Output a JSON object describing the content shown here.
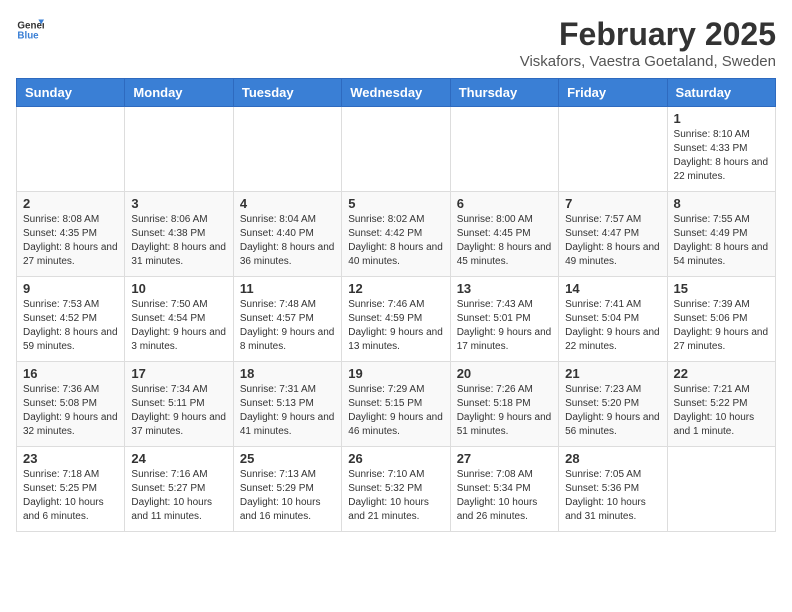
{
  "logo": {
    "general": "General",
    "blue": "Blue"
  },
  "title": "February 2025",
  "subtitle": "Viskafors, Vaestra Goetaland, Sweden",
  "days_of_week": [
    "Sunday",
    "Monday",
    "Tuesday",
    "Wednesday",
    "Thursday",
    "Friday",
    "Saturday"
  ],
  "weeks": [
    [
      {
        "day": "",
        "info": ""
      },
      {
        "day": "",
        "info": ""
      },
      {
        "day": "",
        "info": ""
      },
      {
        "day": "",
        "info": ""
      },
      {
        "day": "",
        "info": ""
      },
      {
        "day": "",
        "info": ""
      },
      {
        "day": "1",
        "info": "Sunrise: 8:10 AM\nSunset: 4:33 PM\nDaylight: 8 hours and 22 minutes."
      }
    ],
    [
      {
        "day": "2",
        "info": "Sunrise: 8:08 AM\nSunset: 4:35 PM\nDaylight: 8 hours and 27 minutes."
      },
      {
        "day": "3",
        "info": "Sunrise: 8:06 AM\nSunset: 4:38 PM\nDaylight: 8 hours and 31 minutes."
      },
      {
        "day": "4",
        "info": "Sunrise: 8:04 AM\nSunset: 4:40 PM\nDaylight: 8 hours and 36 minutes."
      },
      {
        "day": "5",
        "info": "Sunrise: 8:02 AM\nSunset: 4:42 PM\nDaylight: 8 hours and 40 minutes."
      },
      {
        "day": "6",
        "info": "Sunrise: 8:00 AM\nSunset: 4:45 PM\nDaylight: 8 hours and 45 minutes."
      },
      {
        "day": "7",
        "info": "Sunrise: 7:57 AM\nSunset: 4:47 PM\nDaylight: 8 hours and 49 minutes."
      },
      {
        "day": "8",
        "info": "Sunrise: 7:55 AM\nSunset: 4:49 PM\nDaylight: 8 hours and 54 minutes."
      }
    ],
    [
      {
        "day": "9",
        "info": "Sunrise: 7:53 AM\nSunset: 4:52 PM\nDaylight: 8 hours and 59 minutes."
      },
      {
        "day": "10",
        "info": "Sunrise: 7:50 AM\nSunset: 4:54 PM\nDaylight: 9 hours and 3 minutes."
      },
      {
        "day": "11",
        "info": "Sunrise: 7:48 AM\nSunset: 4:57 PM\nDaylight: 9 hours and 8 minutes."
      },
      {
        "day": "12",
        "info": "Sunrise: 7:46 AM\nSunset: 4:59 PM\nDaylight: 9 hours and 13 minutes."
      },
      {
        "day": "13",
        "info": "Sunrise: 7:43 AM\nSunset: 5:01 PM\nDaylight: 9 hours and 17 minutes."
      },
      {
        "day": "14",
        "info": "Sunrise: 7:41 AM\nSunset: 5:04 PM\nDaylight: 9 hours and 22 minutes."
      },
      {
        "day": "15",
        "info": "Sunrise: 7:39 AM\nSunset: 5:06 PM\nDaylight: 9 hours and 27 minutes."
      }
    ],
    [
      {
        "day": "16",
        "info": "Sunrise: 7:36 AM\nSunset: 5:08 PM\nDaylight: 9 hours and 32 minutes."
      },
      {
        "day": "17",
        "info": "Sunrise: 7:34 AM\nSunset: 5:11 PM\nDaylight: 9 hours and 37 minutes."
      },
      {
        "day": "18",
        "info": "Sunrise: 7:31 AM\nSunset: 5:13 PM\nDaylight: 9 hours and 41 minutes."
      },
      {
        "day": "19",
        "info": "Sunrise: 7:29 AM\nSunset: 5:15 PM\nDaylight: 9 hours and 46 minutes."
      },
      {
        "day": "20",
        "info": "Sunrise: 7:26 AM\nSunset: 5:18 PM\nDaylight: 9 hours and 51 minutes."
      },
      {
        "day": "21",
        "info": "Sunrise: 7:23 AM\nSunset: 5:20 PM\nDaylight: 9 hours and 56 minutes."
      },
      {
        "day": "22",
        "info": "Sunrise: 7:21 AM\nSunset: 5:22 PM\nDaylight: 10 hours and 1 minute."
      }
    ],
    [
      {
        "day": "23",
        "info": "Sunrise: 7:18 AM\nSunset: 5:25 PM\nDaylight: 10 hours and 6 minutes."
      },
      {
        "day": "24",
        "info": "Sunrise: 7:16 AM\nSunset: 5:27 PM\nDaylight: 10 hours and 11 minutes."
      },
      {
        "day": "25",
        "info": "Sunrise: 7:13 AM\nSunset: 5:29 PM\nDaylight: 10 hours and 16 minutes."
      },
      {
        "day": "26",
        "info": "Sunrise: 7:10 AM\nSunset: 5:32 PM\nDaylight: 10 hours and 21 minutes."
      },
      {
        "day": "27",
        "info": "Sunrise: 7:08 AM\nSunset: 5:34 PM\nDaylight: 10 hours and 26 minutes."
      },
      {
        "day": "28",
        "info": "Sunrise: 7:05 AM\nSunset: 5:36 PM\nDaylight: 10 hours and 31 minutes."
      },
      {
        "day": "",
        "info": ""
      }
    ]
  ]
}
